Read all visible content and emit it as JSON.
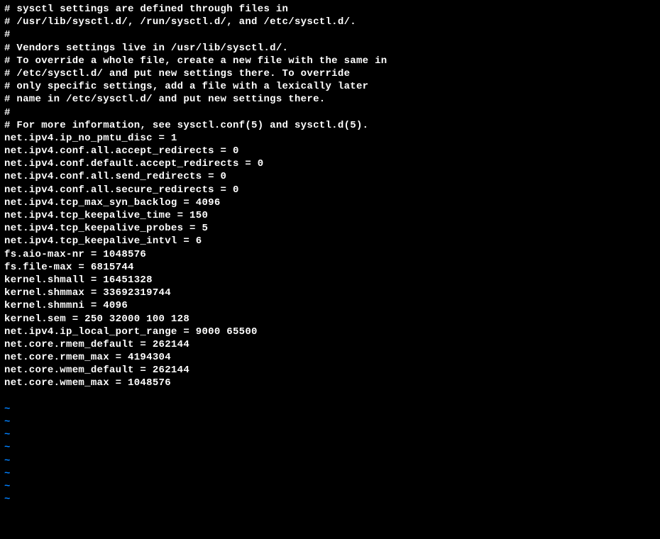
{
  "lines": [
    "# sysctl settings are defined through files in",
    "# /usr/lib/sysctl.d/, /run/sysctl.d/, and /etc/sysctl.d/.",
    "#",
    "# Vendors settings live in /usr/lib/sysctl.d/.",
    "# To override a whole file, create a new file with the same in",
    "# /etc/sysctl.d/ and put new settings there. To override",
    "# only specific settings, add a file with a lexically later",
    "# name in /etc/sysctl.d/ and put new settings there.",
    "#",
    "# For more information, see sysctl.conf(5) and sysctl.d(5).",
    "net.ipv4.ip_no_pmtu_disc = 1",
    "net.ipv4.conf.all.accept_redirects = 0",
    "net.ipv4.conf.default.accept_redirects = 0",
    "net.ipv4.conf.all.send_redirects = 0",
    "net.ipv4.conf.all.secure_redirects = 0",
    "net.ipv4.tcp_max_syn_backlog = 4096",
    "net.ipv4.tcp_keepalive_time = 150",
    "net.ipv4.tcp_keepalive_probes = 5",
    "net.ipv4.tcp_keepalive_intvl = 6",
    "fs.aio-max-nr = 1048576",
    "fs.file-max = 6815744",
    "kernel.shmall = 16451328",
    "kernel.shmmax = 33692319744",
    "kernel.shmmni = 4096",
    "kernel.sem = 250 32000 100 128",
    "net.ipv4.ip_local_port_range = 9000 65500",
    "net.core.rmem_default = 262144",
    "net.core.rmem_max = 4194304",
    "net.core.wmem_default = 262144",
    "net.core.wmem_max = 1048576"
  ],
  "tilde_count": 8,
  "tilde_char": "~"
}
